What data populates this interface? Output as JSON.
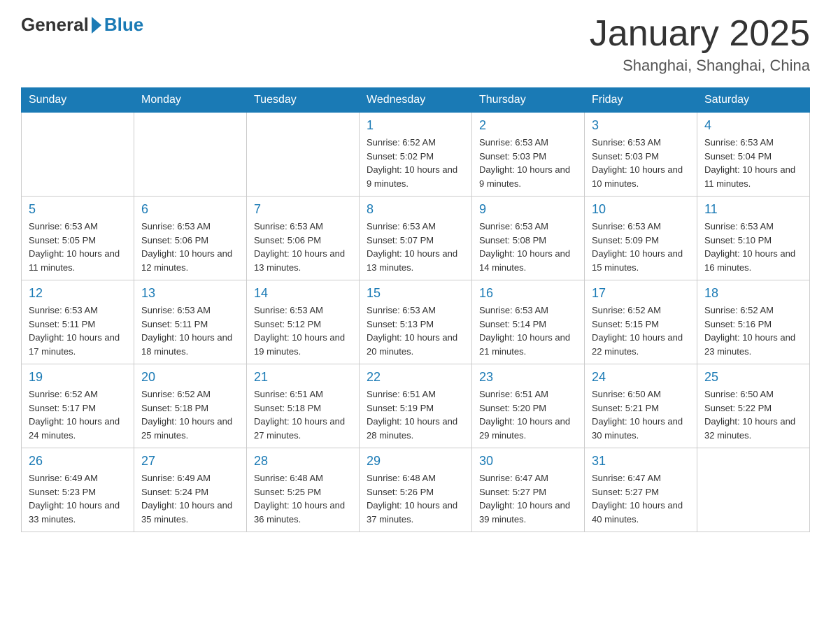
{
  "header": {
    "logo": {
      "general": "General",
      "blue": "Blue"
    },
    "title": "January 2025",
    "location": "Shanghai, Shanghai, China"
  },
  "days_of_week": [
    "Sunday",
    "Monday",
    "Tuesday",
    "Wednesday",
    "Thursday",
    "Friday",
    "Saturday"
  ],
  "weeks": [
    [
      {
        "day": "",
        "info": ""
      },
      {
        "day": "",
        "info": ""
      },
      {
        "day": "",
        "info": ""
      },
      {
        "day": "1",
        "info": "Sunrise: 6:52 AM\nSunset: 5:02 PM\nDaylight: 10 hours and 9 minutes."
      },
      {
        "day": "2",
        "info": "Sunrise: 6:53 AM\nSunset: 5:03 PM\nDaylight: 10 hours and 9 minutes."
      },
      {
        "day": "3",
        "info": "Sunrise: 6:53 AM\nSunset: 5:03 PM\nDaylight: 10 hours and 10 minutes."
      },
      {
        "day": "4",
        "info": "Sunrise: 6:53 AM\nSunset: 5:04 PM\nDaylight: 10 hours and 11 minutes."
      }
    ],
    [
      {
        "day": "5",
        "info": "Sunrise: 6:53 AM\nSunset: 5:05 PM\nDaylight: 10 hours and 11 minutes."
      },
      {
        "day": "6",
        "info": "Sunrise: 6:53 AM\nSunset: 5:06 PM\nDaylight: 10 hours and 12 minutes."
      },
      {
        "day": "7",
        "info": "Sunrise: 6:53 AM\nSunset: 5:06 PM\nDaylight: 10 hours and 13 minutes."
      },
      {
        "day": "8",
        "info": "Sunrise: 6:53 AM\nSunset: 5:07 PM\nDaylight: 10 hours and 13 minutes."
      },
      {
        "day": "9",
        "info": "Sunrise: 6:53 AM\nSunset: 5:08 PM\nDaylight: 10 hours and 14 minutes."
      },
      {
        "day": "10",
        "info": "Sunrise: 6:53 AM\nSunset: 5:09 PM\nDaylight: 10 hours and 15 minutes."
      },
      {
        "day": "11",
        "info": "Sunrise: 6:53 AM\nSunset: 5:10 PM\nDaylight: 10 hours and 16 minutes."
      }
    ],
    [
      {
        "day": "12",
        "info": "Sunrise: 6:53 AM\nSunset: 5:11 PM\nDaylight: 10 hours and 17 minutes."
      },
      {
        "day": "13",
        "info": "Sunrise: 6:53 AM\nSunset: 5:11 PM\nDaylight: 10 hours and 18 minutes."
      },
      {
        "day": "14",
        "info": "Sunrise: 6:53 AM\nSunset: 5:12 PM\nDaylight: 10 hours and 19 minutes."
      },
      {
        "day": "15",
        "info": "Sunrise: 6:53 AM\nSunset: 5:13 PM\nDaylight: 10 hours and 20 minutes."
      },
      {
        "day": "16",
        "info": "Sunrise: 6:53 AM\nSunset: 5:14 PM\nDaylight: 10 hours and 21 minutes."
      },
      {
        "day": "17",
        "info": "Sunrise: 6:52 AM\nSunset: 5:15 PM\nDaylight: 10 hours and 22 minutes."
      },
      {
        "day": "18",
        "info": "Sunrise: 6:52 AM\nSunset: 5:16 PM\nDaylight: 10 hours and 23 minutes."
      }
    ],
    [
      {
        "day": "19",
        "info": "Sunrise: 6:52 AM\nSunset: 5:17 PM\nDaylight: 10 hours and 24 minutes."
      },
      {
        "day": "20",
        "info": "Sunrise: 6:52 AM\nSunset: 5:18 PM\nDaylight: 10 hours and 25 minutes."
      },
      {
        "day": "21",
        "info": "Sunrise: 6:51 AM\nSunset: 5:18 PM\nDaylight: 10 hours and 27 minutes."
      },
      {
        "day": "22",
        "info": "Sunrise: 6:51 AM\nSunset: 5:19 PM\nDaylight: 10 hours and 28 minutes."
      },
      {
        "day": "23",
        "info": "Sunrise: 6:51 AM\nSunset: 5:20 PM\nDaylight: 10 hours and 29 minutes."
      },
      {
        "day": "24",
        "info": "Sunrise: 6:50 AM\nSunset: 5:21 PM\nDaylight: 10 hours and 30 minutes."
      },
      {
        "day": "25",
        "info": "Sunrise: 6:50 AM\nSunset: 5:22 PM\nDaylight: 10 hours and 32 minutes."
      }
    ],
    [
      {
        "day": "26",
        "info": "Sunrise: 6:49 AM\nSunset: 5:23 PM\nDaylight: 10 hours and 33 minutes."
      },
      {
        "day": "27",
        "info": "Sunrise: 6:49 AM\nSunset: 5:24 PM\nDaylight: 10 hours and 35 minutes."
      },
      {
        "day": "28",
        "info": "Sunrise: 6:48 AM\nSunset: 5:25 PM\nDaylight: 10 hours and 36 minutes."
      },
      {
        "day": "29",
        "info": "Sunrise: 6:48 AM\nSunset: 5:26 PM\nDaylight: 10 hours and 37 minutes."
      },
      {
        "day": "30",
        "info": "Sunrise: 6:47 AM\nSunset: 5:27 PM\nDaylight: 10 hours and 39 minutes."
      },
      {
        "day": "31",
        "info": "Sunrise: 6:47 AM\nSunset: 5:27 PM\nDaylight: 10 hours and 40 minutes."
      },
      {
        "day": "",
        "info": ""
      }
    ]
  ]
}
